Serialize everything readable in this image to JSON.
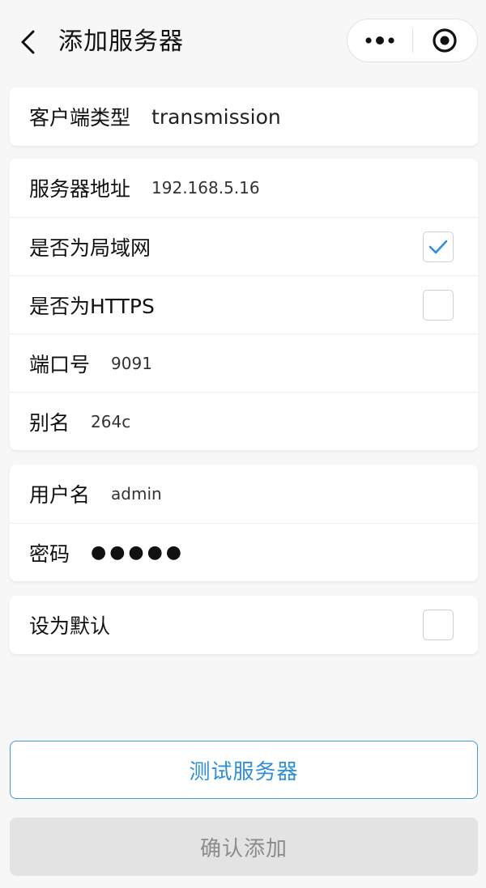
{
  "header": {
    "title": "添加服务器",
    "back_icon": "chevron-left-icon",
    "more_icon": "more-dots-icon",
    "close_icon": "target-close-icon"
  },
  "client_card": {
    "label": "客户端类型",
    "value": "transmission"
  },
  "server_card": {
    "address_label": "服务器地址",
    "address_value": "192.168.5.16",
    "lan_label": "是否为局域网",
    "lan_checked": true,
    "https_label": "是否为HTTPS",
    "https_checked": false,
    "port_label": "端口号",
    "port_value": "9091",
    "alias_label": "别名",
    "alias_value": "264c"
  },
  "auth_card": {
    "username_label": "用户名",
    "username_value": "admin",
    "password_label": "密码",
    "password_value": "●●●●●"
  },
  "default_card": {
    "label": "设为默认",
    "checked": false
  },
  "buttons": {
    "test_label": "测试服务器",
    "confirm_label": "确认添加"
  },
  "colors": {
    "accent": "#2f8fd8",
    "check": "#2f8fd8",
    "disabled_bg": "#e3e3e3",
    "disabled_text": "#8c8c8c"
  }
}
